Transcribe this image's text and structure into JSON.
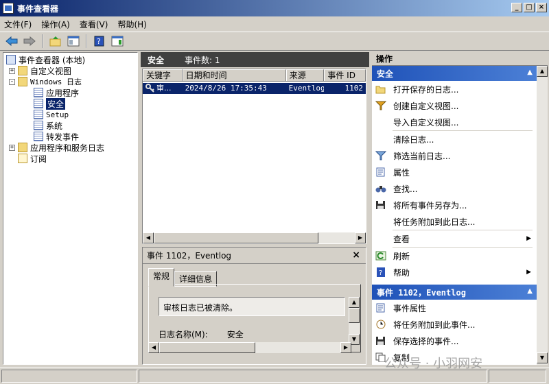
{
  "window": {
    "title": "事件查看器"
  },
  "menu": [
    "文件(F)",
    "操作(A)",
    "查看(V)",
    "帮助(H)"
  ],
  "tree": {
    "root": "事件查看器 (本地)",
    "custom_views": "自定义视图",
    "windows_logs": "Windows 日志",
    "logs": [
      "应用程序",
      "安全",
      "Setup",
      "系统",
      "转发事件"
    ],
    "app_service_logs": "应用程序和服务日志",
    "subscriptions": "订阅"
  },
  "middle": {
    "title": "安全",
    "count_label": "事件数: 1",
    "columns": [
      "关键字",
      "日期和时间",
      "来源",
      "事件 ID"
    ],
    "row": {
      "keyword": "审...",
      "datetime": "2024/8/26 17:35:43",
      "source": "Eventlog",
      "event_id": "1102"
    }
  },
  "detail": {
    "title": "事件 1102，Eventlog",
    "tabs": [
      "常规",
      "详细信息"
    ],
    "description": "审核日志已被清除。",
    "log_name_label": "日志名称(M):",
    "log_name_value": "安全"
  },
  "actions": {
    "header": "操作",
    "section1": "安全",
    "items1": [
      "打开保存的日志...",
      "创建自定义视图...",
      "导入自定义视图...",
      "清除日志...",
      "筛选当前日志...",
      "属性",
      "查找...",
      "将所有事件另存为...",
      "将任务附加到此日志...",
      "查看",
      "刷新",
      "帮助"
    ],
    "section2": "事件 1102，Eventlog",
    "items2": [
      "事件属性",
      "将任务附加到此事件...",
      "保存选择的事件...",
      "复制"
    ]
  },
  "watermark": "公众号 · 小羽网安"
}
